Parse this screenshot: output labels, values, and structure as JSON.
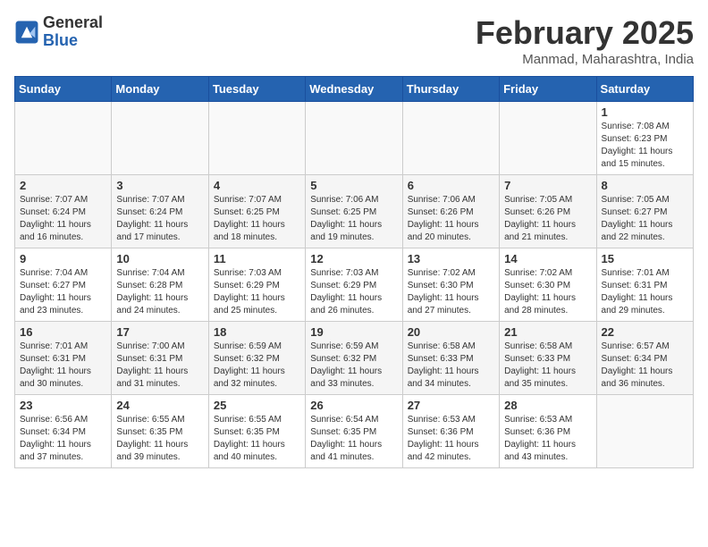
{
  "header": {
    "logo": {
      "general": "General",
      "blue": "Blue"
    },
    "title": "February 2025",
    "subtitle": "Manmad, Maharashtra, India"
  },
  "weekdays": [
    "Sunday",
    "Monday",
    "Tuesday",
    "Wednesday",
    "Thursday",
    "Friday",
    "Saturday"
  ],
  "weeks": [
    [
      {
        "day": "",
        "sunrise": "",
        "sunset": "",
        "daylight": ""
      },
      {
        "day": "",
        "sunrise": "",
        "sunset": "",
        "daylight": ""
      },
      {
        "day": "",
        "sunrise": "",
        "sunset": "",
        "daylight": ""
      },
      {
        "day": "",
        "sunrise": "",
        "sunset": "",
        "daylight": ""
      },
      {
        "day": "",
        "sunrise": "",
        "sunset": "",
        "daylight": ""
      },
      {
        "day": "",
        "sunrise": "",
        "sunset": "",
        "daylight": ""
      },
      {
        "day": "1",
        "sunrise": "7:08 AM",
        "sunset": "6:23 PM",
        "daylight": "11 hours and 15 minutes."
      }
    ],
    [
      {
        "day": "2",
        "sunrise": "7:07 AM",
        "sunset": "6:24 PM",
        "daylight": "11 hours and 16 minutes."
      },
      {
        "day": "3",
        "sunrise": "7:07 AM",
        "sunset": "6:24 PM",
        "daylight": "11 hours and 17 minutes."
      },
      {
        "day": "4",
        "sunrise": "7:07 AM",
        "sunset": "6:25 PM",
        "daylight": "11 hours and 18 minutes."
      },
      {
        "day": "5",
        "sunrise": "7:06 AM",
        "sunset": "6:25 PM",
        "daylight": "11 hours and 19 minutes."
      },
      {
        "day": "6",
        "sunrise": "7:06 AM",
        "sunset": "6:26 PM",
        "daylight": "11 hours and 20 minutes."
      },
      {
        "day": "7",
        "sunrise": "7:05 AM",
        "sunset": "6:26 PM",
        "daylight": "11 hours and 21 minutes."
      },
      {
        "day": "8",
        "sunrise": "7:05 AM",
        "sunset": "6:27 PM",
        "daylight": "11 hours and 22 minutes."
      }
    ],
    [
      {
        "day": "9",
        "sunrise": "7:04 AM",
        "sunset": "6:27 PM",
        "daylight": "11 hours and 23 minutes."
      },
      {
        "day": "10",
        "sunrise": "7:04 AM",
        "sunset": "6:28 PM",
        "daylight": "11 hours and 24 minutes."
      },
      {
        "day": "11",
        "sunrise": "7:03 AM",
        "sunset": "6:29 PM",
        "daylight": "11 hours and 25 minutes."
      },
      {
        "day": "12",
        "sunrise": "7:03 AM",
        "sunset": "6:29 PM",
        "daylight": "11 hours and 26 minutes."
      },
      {
        "day": "13",
        "sunrise": "7:02 AM",
        "sunset": "6:30 PM",
        "daylight": "11 hours and 27 minutes."
      },
      {
        "day": "14",
        "sunrise": "7:02 AM",
        "sunset": "6:30 PM",
        "daylight": "11 hours and 28 minutes."
      },
      {
        "day": "15",
        "sunrise": "7:01 AM",
        "sunset": "6:31 PM",
        "daylight": "11 hours and 29 minutes."
      }
    ],
    [
      {
        "day": "16",
        "sunrise": "7:01 AM",
        "sunset": "6:31 PM",
        "daylight": "11 hours and 30 minutes."
      },
      {
        "day": "17",
        "sunrise": "7:00 AM",
        "sunset": "6:31 PM",
        "daylight": "11 hours and 31 minutes."
      },
      {
        "day": "18",
        "sunrise": "6:59 AM",
        "sunset": "6:32 PM",
        "daylight": "11 hours and 32 minutes."
      },
      {
        "day": "19",
        "sunrise": "6:59 AM",
        "sunset": "6:32 PM",
        "daylight": "11 hours and 33 minutes."
      },
      {
        "day": "20",
        "sunrise": "6:58 AM",
        "sunset": "6:33 PM",
        "daylight": "11 hours and 34 minutes."
      },
      {
        "day": "21",
        "sunrise": "6:58 AM",
        "sunset": "6:33 PM",
        "daylight": "11 hours and 35 minutes."
      },
      {
        "day": "22",
        "sunrise": "6:57 AM",
        "sunset": "6:34 PM",
        "daylight": "11 hours and 36 minutes."
      }
    ],
    [
      {
        "day": "23",
        "sunrise": "6:56 AM",
        "sunset": "6:34 PM",
        "daylight": "11 hours and 37 minutes."
      },
      {
        "day": "24",
        "sunrise": "6:55 AM",
        "sunset": "6:35 PM",
        "daylight": "11 hours and 39 minutes."
      },
      {
        "day": "25",
        "sunrise": "6:55 AM",
        "sunset": "6:35 PM",
        "daylight": "11 hours and 40 minutes."
      },
      {
        "day": "26",
        "sunrise": "6:54 AM",
        "sunset": "6:35 PM",
        "daylight": "11 hours and 41 minutes."
      },
      {
        "day": "27",
        "sunrise": "6:53 AM",
        "sunset": "6:36 PM",
        "daylight": "11 hours and 42 minutes."
      },
      {
        "day": "28",
        "sunrise": "6:53 AM",
        "sunset": "6:36 PM",
        "daylight": "11 hours and 43 minutes."
      },
      {
        "day": "",
        "sunrise": "",
        "sunset": "",
        "daylight": ""
      }
    ]
  ]
}
